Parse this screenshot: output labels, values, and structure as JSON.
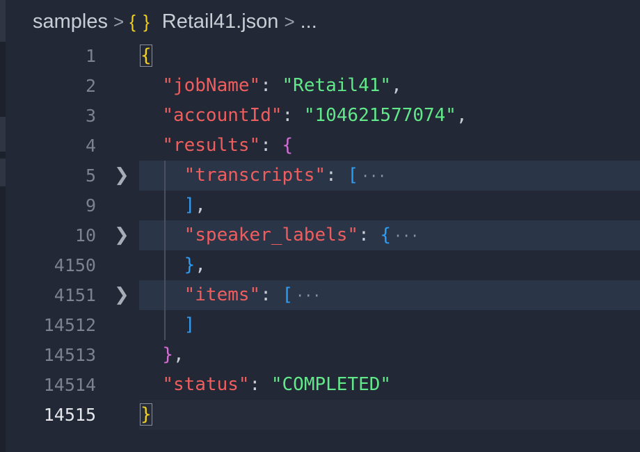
{
  "breadcrumb": {
    "folder": "samples",
    "separator": ">",
    "file_icon": "{ }",
    "file": "Retail41.json",
    "more": "..."
  },
  "editor": {
    "lines": [
      {
        "number": "1"
      },
      {
        "number": "2"
      },
      {
        "number": "3"
      },
      {
        "number": "4"
      },
      {
        "number": "5"
      },
      {
        "number": "9"
      },
      {
        "number": "10"
      },
      {
        "number": "4150"
      },
      {
        "number": "4151"
      },
      {
        "number": "14512"
      },
      {
        "number": "14513"
      },
      {
        "number": "14514"
      },
      {
        "number": "14515"
      }
    ],
    "content": {
      "open_brace": "{",
      "jobName_key": "\"jobName\"",
      "jobName_value": "\"Retail41\"",
      "accountId_key": "\"accountId\"",
      "accountId_value": "\"104621577074\"",
      "results_key": "\"results\"",
      "transcripts_key": "\"transcripts\"",
      "speaker_labels_key": "\"speaker_labels\"",
      "items_key": "\"items\"",
      "status_key": "\"status\"",
      "status_value": "\"COMPLETED\"",
      "close_brace": "}",
      "fold_ellipsis": "···"
    }
  },
  "colors": {
    "background": "#222835",
    "key": "#ef5e5e",
    "string": "#62e88a",
    "bracket_level1": "#f1d022",
    "bracket_level2": "#d66cd6",
    "bracket_level3": "#2f9cf4",
    "folded_line_highlight": "#2b3548"
  },
  "icons": {
    "fold_chevron": "chevron-right-icon",
    "file_type": "json-icon"
  }
}
